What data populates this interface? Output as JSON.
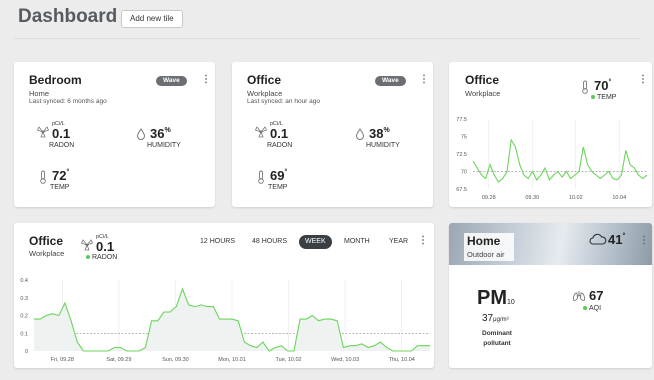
{
  "header": {
    "title": "Dashboard",
    "add_tile_label": "Add new tile"
  },
  "colors": {
    "accent_green": "#6cd45b",
    "dark": "#3a3f44",
    "threshold_line": "#777777"
  },
  "tiles": {
    "bedroom": {
      "title": "Bedroom",
      "subtitle": "Home",
      "synced": "Last synced: 6 months ago",
      "badge": "Wave",
      "radon_unit": "pCi/L",
      "radon_value": "0.1",
      "radon_label": "RADON",
      "humidity_value": "36",
      "humidity_unit": "%",
      "humidity_label": "HUMIDITY",
      "temp_value": "72",
      "temp_unit": "°",
      "temp_label": "TEMP"
    },
    "office_small": {
      "title": "Office",
      "subtitle": "Workplace",
      "synced": "Last synced: an hour ago",
      "badge": "Wave",
      "radon_unit": "pCi/L",
      "radon_value": "0.1",
      "radon_label": "RADON",
      "humidity_value": "38",
      "humidity_unit": "%",
      "humidity_label": "HUMIDITY",
      "temp_value": "69",
      "temp_unit": "°",
      "temp_label": "TEMP"
    },
    "office_temp": {
      "title": "Office",
      "subtitle": "Workplace",
      "temp_value": "70",
      "temp_unit": "°",
      "temp_label": "TEMP"
    },
    "office_radon": {
      "title": "Office",
      "subtitle": "Workplace",
      "radon_unit": "pCi/L",
      "radon_value": "0.1",
      "radon_label": "RADON",
      "tabs": [
        "12 HOURS",
        "48 HOURS",
        "WEEK",
        "MONTH",
        "YEAR"
      ],
      "active_tab": "WEEK"
    },
    "home_outdoor": {
      "title": "Home",
      "subtitle": "Outdoor air",
      "temp_value": "41",
      "temp_unit": "°",
      "pm_label": "PM",
      "pm_sub": "10",
      "pm_value": "37",
      "pm_unit": "μg/m³",
      "pm_caption_1": "Dominant",
      "pm_caption_2": "pollutant",
      "aqi_value": "67",
      "aqi_label": "AQI"
    }
  },
  "chart_data": [
    {
      "type": "line",
      "title": "",
      "x_ticks": [
        "09.28",
        "09.30",
        "10.02",
        "10.04"
      ],
      "ylim": [
        67.5,
        77.5
      ],
      "y_ticks": [
        67.5,
        70,
        72.5,
        75,
        77.5
      ],
      "threshold": 70,
      "series": [
        {
          "values": [
            71.5,
            70.5,
            69.5,
            69.0,
            71.0,
            69.5,
            68.5,
            69.0,
            70.0,
            74.5,
            73.5,
            71.0,
            69.5,
            69.0,
            70.0,
            68.8,
            69.5,
            70.5,
            68.8,
            69.5,
            70.0,
            69.2,
            70.0,
            69.0,
            69.5,
            70.0,
            73.5,
            71.0,
            70.0,
            69.5,
            69.0,
            69.5,
            70.0,
            69.0,
            68.8,
            69.5,
            73.0,
            71.0,
            70.5,
            69.5,
            69.0,
            69.5
          ]
        }
      ]
    },
    {
      "type": "area",
      "title": "",
      "x_ticks": [
        "Fri, 09.28",
        "Sat, 09.29",
        "Sun, 09.30",
        "Mon, 10.01",
        "Tue, 10.02",
        "Wed, 10.03",
        "Thu, 10.04"
      ],
      "ylim": [
        0,
        0.4
      ],
      "y_ticks": [
        0,
        0.1,
        0.2,
        0.3,
        0.4
      ],
      "threshold": 0.1,
      "series": [
        {
          "values": [
            0.18,
            0.18,
            0.2,
            0.21,
            0.2,
            0.27,
            0.17,
            0.05,
            0.0,
            0.0,
            0.0,
            0.0,
            0.0,
            0.02,
            0.02,
            0.0,
            0.0,
            0.0,
            0.02,
            0.17,
            0.17,
            0.22,
            0.22,
            0.25,
            0.35,
            0.26,
            0.25,
            0.26,
            0.25,
            0.25,
            0.18,
            0.18,
            0.18,
            0.17,
            0.05,
            0.03,
            0.02,
            0.05,
            0.0,
            0.02,
            0.03,
            0.0,
            0.0,
            0.18,
            0.18,
            0.2,
            0.17,
            0.18,
            0.18,
            0.17,
            0.02,
            0.03,
            0.03,
            0.04,
            0.02,
            0.03,
            0.05,
            0.02,
            0.0,
            0.0,
            0.0,
            0.0,
            0.03,
            0.03,
            0.03
          ]
        }
      ]
    }
  ]
}
